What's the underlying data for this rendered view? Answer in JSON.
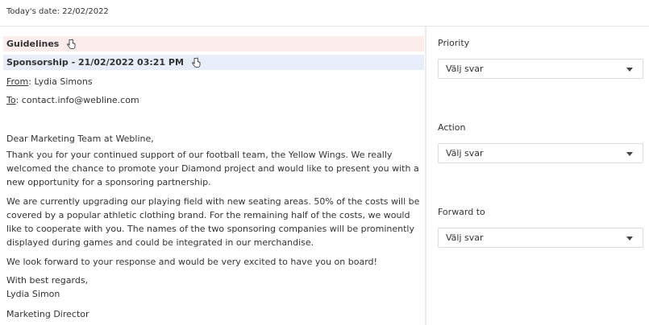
{
  "header": {
    "date_text": "Today's date: 22/02/2022"
  },
  "email": {
    "guidelines_label": "Guidelines",
    "subject": "Sponsorship - 21/02/2022 03:21 PM",
    "from_label": "From",
    "from_value": ": Lydia Simons",
    "to_label": "To",
    "to_value": ": contact.info@webline.com",
    "greeting": "Dear Marketing Team at Webline,",
    "paragraph_1": "Thank you for your continued support of our football team, the Yellow Wings. We really welcomed the chance to promote your Diamond project and would like to present you with a new opportunity for a sponsoring partnership.",
    "paragraph_2": "We are currently upgrading our playing field with new seating areas. 50% of the costs will be covered by a popular athletic clothing brand. For the remaining half of the costs, we would like to cooperate with you. The names of the two sponsoring companies will be prominently displayed during games and could be integrated in our merchandise.",
    "paragraph_3": "We look forward to your response and would be very excited to have you on board!",
    "closing": "With best regards,",
    "signer": "Lydia Simon",
    "signer_title": "Marketing Director"
  },
  "form": {
    "priority": {
      "label": "Priority",
      "value": "Välj svar"
    },
    "action": {
      "label": "Action",
      "value": "Välj svar"
    },
    "forward_to": {
      "label": "Forward to",
      "value": "Välj svar"
    }
  },
  "icons": {
    "cursor": "hand-pointer-icon",
    "dropdown": "chevron-down-icon"
  }
}
